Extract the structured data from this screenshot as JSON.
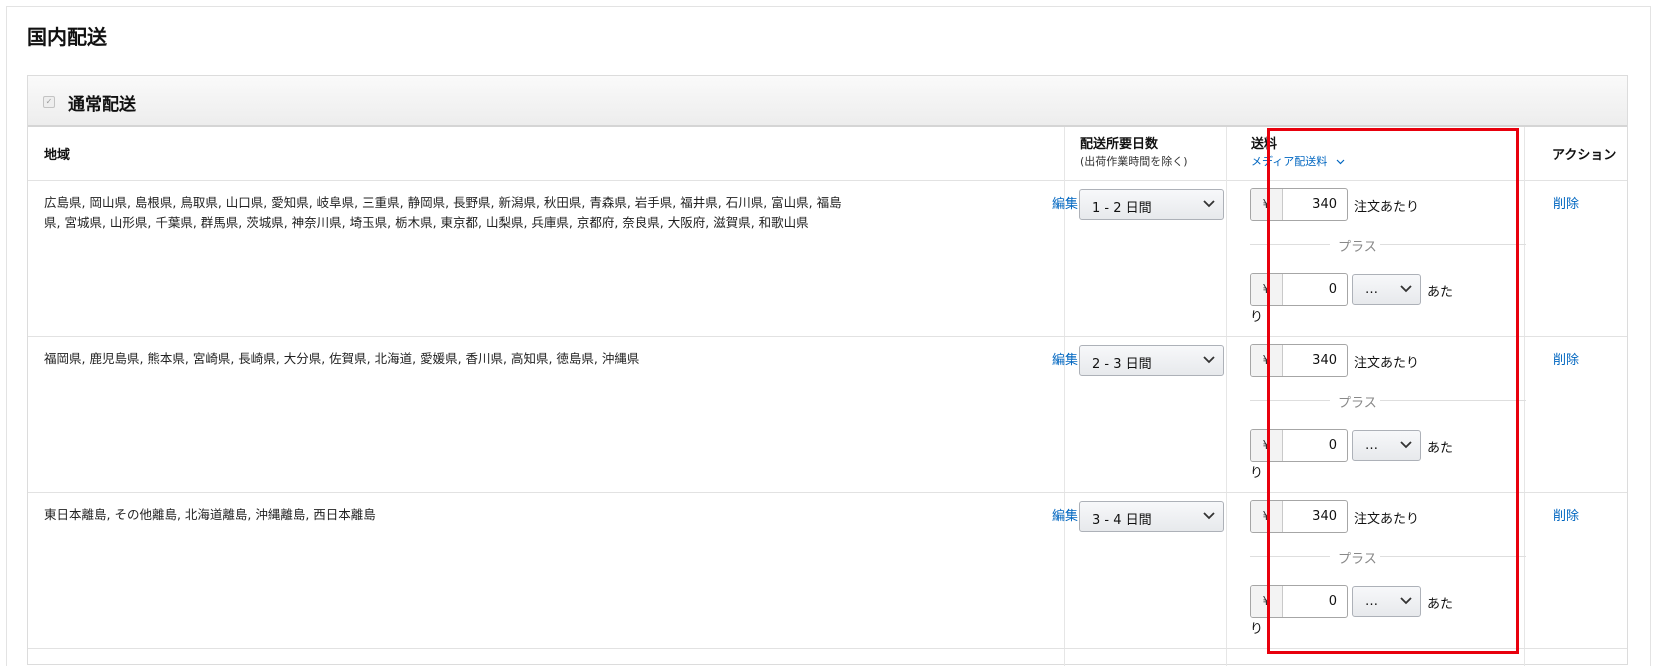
{
  "page": {
    "title": "国内配送"
  },
  "section": {
    "title": "通常配送",
    "checked": true
  },
  "columns": {
    "region": "地域",
    "transit_title": "配送所要日数",
    "transit_sub": "(出荷作業時間を除く)",
    "fee_title": "送料",
    "fee_mode": "メディア配送料",
    "action": "アクション"
  },
  "labels": {
    "edit": "編集",
    "delete": "削除",
    "currency": "¥",
    "per_order": "注文あたり",
    "plus": "プラス",
    "per_unit_a": "あた",
    "per_unit_b": "り",
    "unit_select": "…"
  },
  "rows": [
    {
      "regions": "広島県, 岡山県, 島根県, 鳥取県, 山口県, 愛知県, 岐阜県, 三重県, 静岡県, 長野県, 新潟県, 秋田県, 青森県, 岩手県, 福井県, 石川県, 富山県, 福島県, 宮城県, 山形県, 千葉県, 群馬県, 茨城県, 神奈川県, 埼玉県, 栃木県, 東京都, 山梨県, 兵庫県, 京都府, 奈良県, 大阪府, 滋賀県, 和歌山県",
      "transit": "1 - 2 日間",
      "fee": "340",
      "extra": "0"
    },
    {
      "regions": "福岡県, 鹿児島県, 熊本県, 宮崎県, 長崎県, 大分県, 佐賀県, 北海道, 愛媛県, 香川県, 高知県, 徳島県, 沖縄県",
      "transit": "2 - 3 日間",
      "fee": "340",
      "extra": "0"
    },
    {
      "regions": "東日本離島, その他離島, 北海道離島, 沖縄離島, 西日本離島",
      "transit": "3 - 4 日間",
      "fee": "340",
      "extra": "0"
    }
  ],
  "colors": {
    "link": "#0066c0",
    "highlight": "#e8000d"
  }
}
